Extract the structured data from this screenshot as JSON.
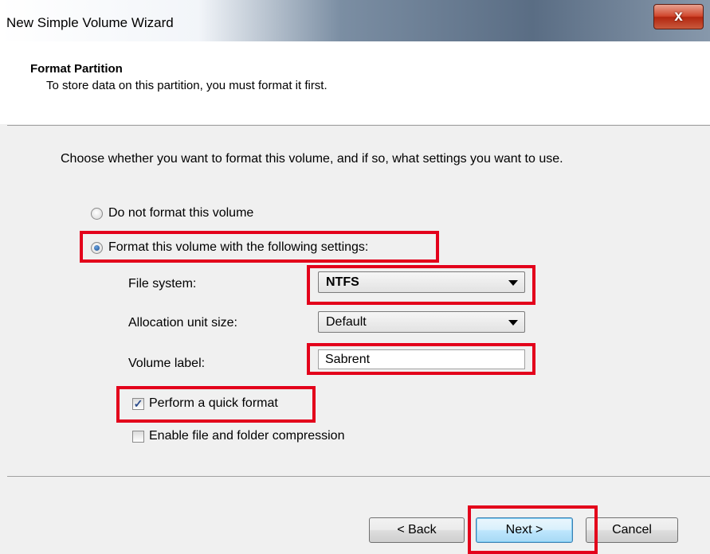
{
  "window": {
    "title": "New Simple Volume Wizard",
    "close_glyph": "x"
  },
  "header": {
    "title": "Format Partition",
    "subtitle": "To store data on this partition, you must format it first."
  },
  "content": {
    "instruction": "Choose whether you want to format this volume, and if so, what settings you want to use.",
    "radio_no_format": {
      "label": "Do not format this volume",
      "selected": false
    },
    "radio_format": {
      "label": "Format this volume with the following settings:",
      "selected": true
    },
    "file_system": {
      "label": "File system:",
      "value": "NTFS"
    },
    "allocation_unit_size": {
      "label": "Allocation unit size:",
      "value": "Default"
    },
    "volume_label": {
      "label": "Volume label:",
      "value": "Sabrent"
    },
    "quick_format": {
      "label": "Perform a quick format",
      "checked": true,
      "check_glyph": "✓"
    },
    "compression": {
      "label": "Enable file and folder compression",
      "checked": false
    }
  },
  "footer": {
    "back_label": "< Back",
    "next_label": "Next >",
    "cancel_label": "Cancel"
  },
  "colors": {
    "highlight": "#e3001b",
    "accent": "#3c7fb1"
  },
  "icons": [
    "close-icon",
    "dropdown-arrow-icon",
    "checkmark-icon",
    "radio-dot-icon"
  ]
}
